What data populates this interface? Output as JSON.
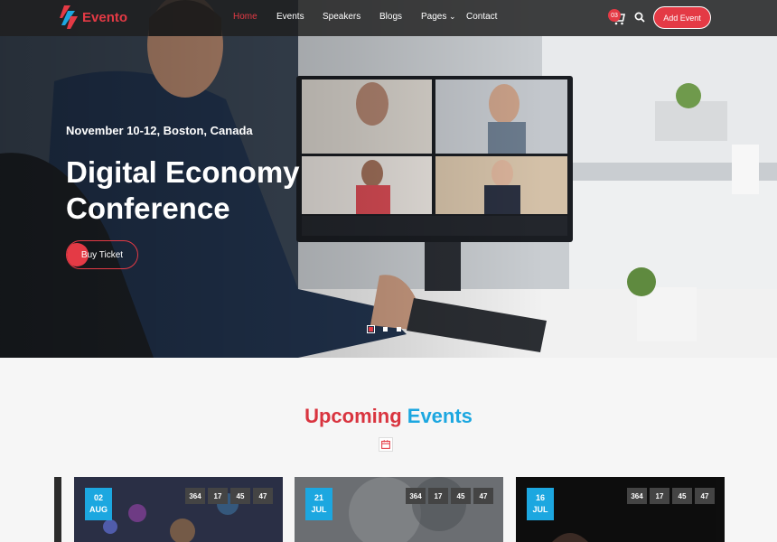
{
  "brand": {
    "name": "Evento",
    "accent": "#e43a45",
    "secondary": "#1ca7e0"
  },
  "nav": {
    "items": [
      "Home",
      "Events",
      "Speakers",
      "Blogs",
      "Pages",
      "Contact"
    ],
    "active": "Home",
    "cart_count": "03",
    "add_event": "Add Event"
  },
  "hero": {
    "date": "November 10-12, Boston, Canada",
    "title_line1": "Digital Economy",
    "title_line2": "Conference",
    "cta": "Buy Ticket",
    "slides": 3,
    "active_slide": 1
  },
  "section": {
    "title_part1": "Upcoming",
    "title_part2": "Events"
  },
  "events": [
    {
      "day": "02",
      "month": "AUG",
      "countdown": [
        "364",
        "17",
        "45",
        "47"
      ]
    },
    {
      "day": "21",
      "month": "JUL",
      "countdown": [
        "364",
        "17",
        "45",
        "47"
      ]
    },
    {
      "day": "16",
      "month": "JUL",
      "countdown": [
        "364",
        "17",
        "45",
        "47"
      ]
    }
  ]
}
